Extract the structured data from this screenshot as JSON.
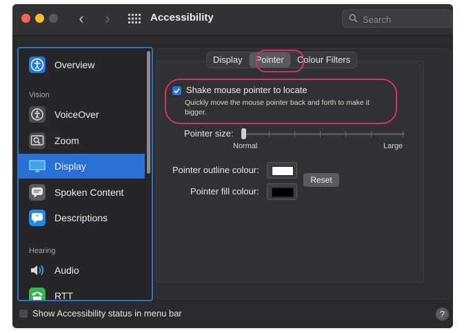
{
  "window": {
    "title": "Accessibility",
    "search": {
      "placeholder": "Search",
      "value": ""
    }
  },
  "sidebar": {
    "sections": [
      "Vision",
      "Hearing"
    ],
    "items": [
      {
        "label": "Overview",
        "icon": "accessibility-icon"
      },
      {
        "label": "VoiceOver",
        "icon": "voiceover-icon"
      },
      {
        "label": "Zoom",
        "icon": "zoom-icon"
      },
      {
        "label": "Display",
        "icon": "display-icon",
        "selected": true
      },
      {
        "label": "Spoken Content",
        "icon": "speech-bubble-icon"
      },
      {
        "label": "Descriptions",
        "icon": "descriptions-icon"
      },
      {
        "label": "Audio",
        "icon": "speaker-icon"
      },
      {
        "label": "RTT",
        "icon": "rtt-icon"
      }
    ]
  },
  "tabs": [
    {
      "label": "Display"
    },
    {
      "label": "Pointer",
      "active": true
    },
    {
      "label": "Colour Filters"
    }
  ],
  "pointer": {
    "shake_label": "Shake mouse pointer to locate",
    "shake_checked": true,
    "shake_description": "Quickly move the mouse pointer back and forth to make it bigger.",
    "size_label": "Pointer size:",
    "size_min": "Normal",
    "size_max": "Large",
    "size_value": 0,
    "outline_label": "Pointer outline colour:",
    "outline_color": "#ffffff",
    "fill_label": "Pointer fill colour:",
    "fill_color": "#000000",
    "reset_label": "Reset"
  },
  "footer": {
    "status_label": "Show Accessibility status in menu bar",
    "status_checked": false,
    "help": "?"
  },
  "colors": {
    "accent": "#2a6fd3",
    "highlight": "#d6306f"
  }
}
